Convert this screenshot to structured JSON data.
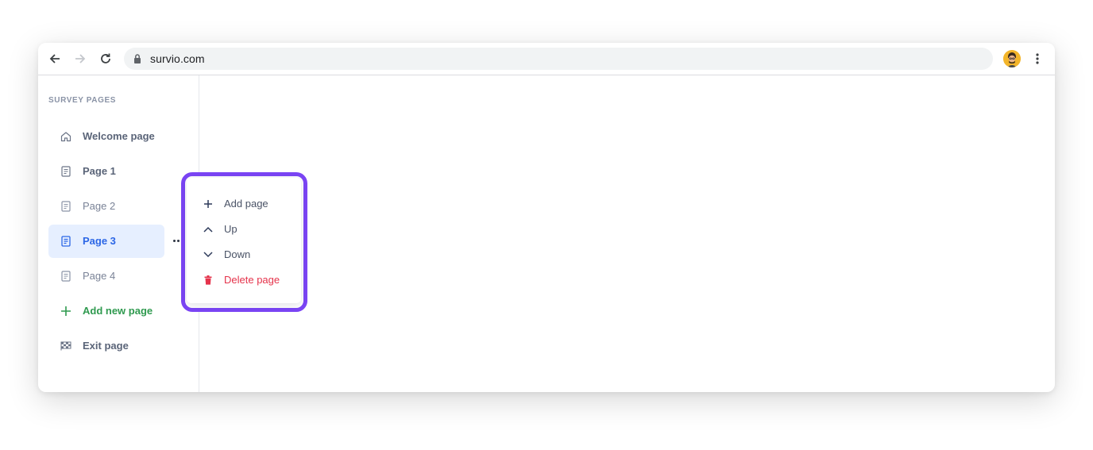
{
  "browser": {
    "url": "survio.com",
    "icons": {
      "back": "arrow-left-icon",
      "forward": "arrow-right-icon",
      "reload": "reload-icon",
      "lock": "lock-icon",
      "menu": "vertical-dots-icon"
    }
  },
  "sidebar": {
    "heading": "SURVEY PAGES",
    "items": [
      {
        "label": "Welcome page",
        "icon": "home-icon"
      },
      {
        "label": "Page 1",
        "icon": "page-icon"
      },
      {
        "label": "Page 2",
        "icon": "page-icon"
      },
      {
        "label": "Page 3",
        "icon": "page-icon",
        "active": true
      },
      {
        "label": "Page 4",
        "icon": "page-icon"
      },
      {
        "label": "Add new page",
        "icon": "plus-icon"
      },
      {
        "label": "Exit page",
        "icon": "finish-flag-icon"
      }
    ]
  },
  "context_menu": {
    "items": [
      {
        "label": "Add page",
        "icon": "plus-icon"
      },
      {
        "label": "Up",
        "icon": "chevron-up-icon"
      },
      {
        "label": "Down",
        "icon": "chevron-down-icon"
      },
      {
        "label": "Delete page",
        "icon": "trash-icon"
      }
    ]
  },
  "colors": {
    "accent": "#2b66e6",
    "active_bg": "#e6efff",
    "add_green": "#2f9a4f",
    "danger": "#e5334b",
    "highlight": "#7b45f5"
  }
}
